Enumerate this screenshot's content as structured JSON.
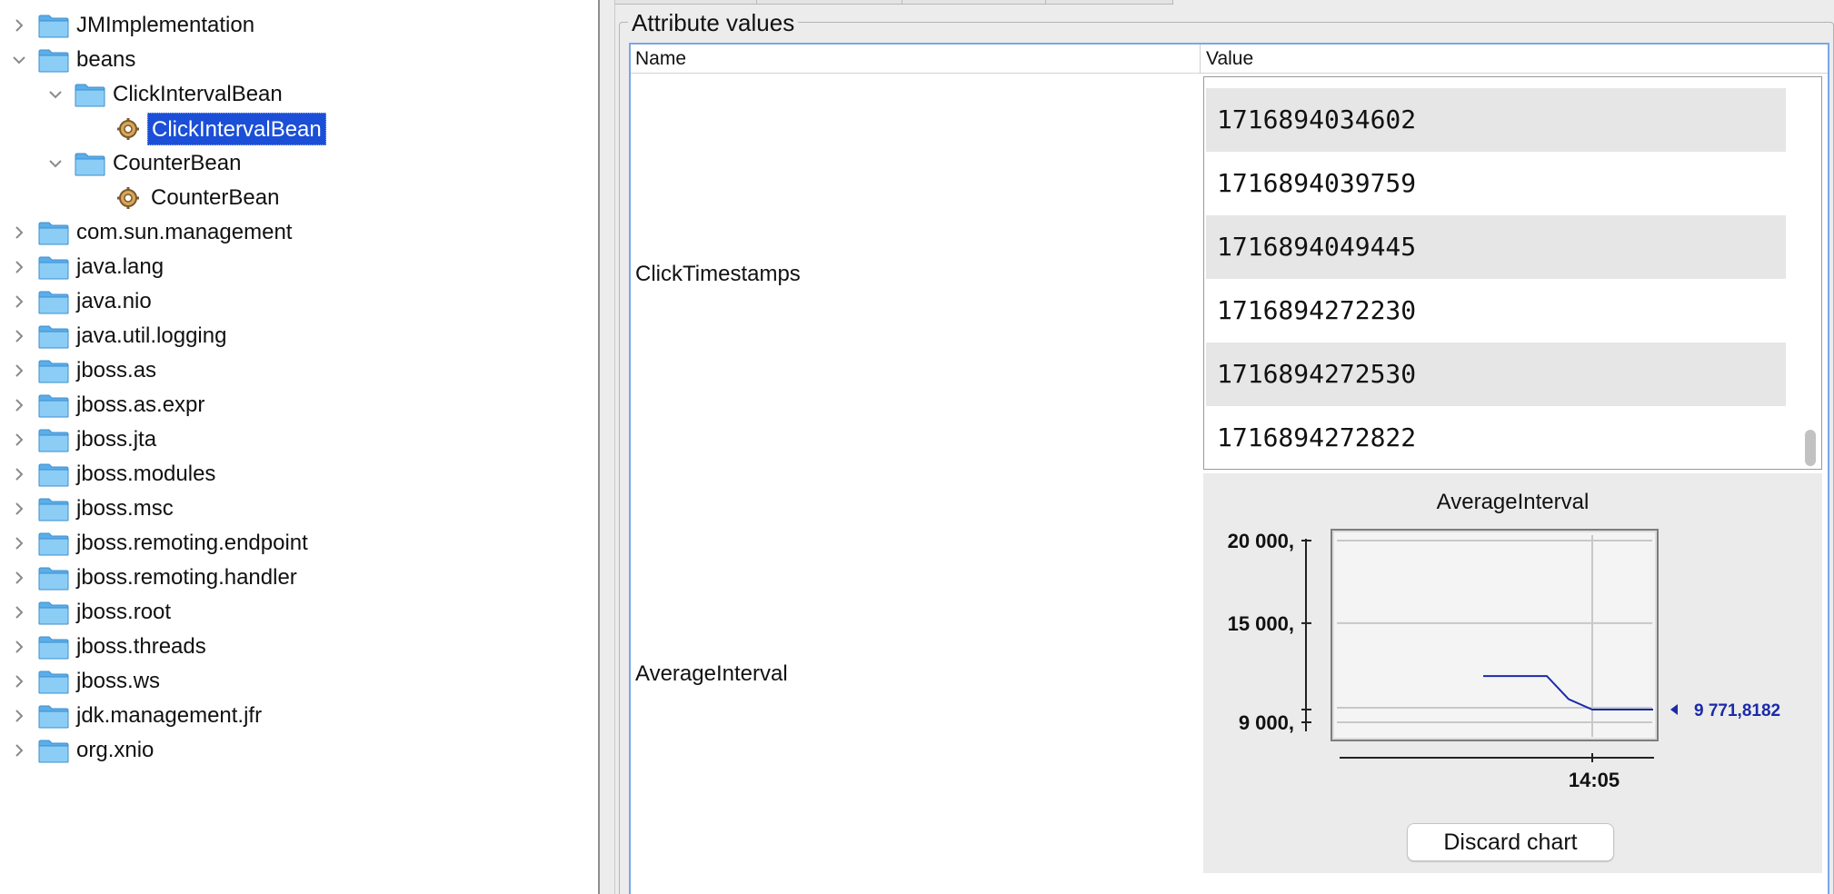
{
  "tree": {
    "items": [
      {
        "label": "JMImplementation",
        "level": 0,
        "type": "folder",
        "expanded": false
      },
      {
        "label": "beans",
        "level": 0,
        "type": "folder",
        "expanded": true
      },
      {
        "label": "ClickIntervalBean",
        "level": 1,
        "type": "folder",
        "expanded": true
      },
      {
        "label": "ClickIntervalBean",
        "level": 2,
        "type": "bean",
        "selected": true
      },
      {
        "label": "CounterBean",
        "level": 1,
        "type": "folder",
        "expanded": true
      },
      {
        "label": "CounterBean",
        "level": 2,
        "type": "bean"
      },
      {
        "label": "com.sun.management",
        "level": 0,
        "type": "folder",
        "expanded": false
      },
      {
        "label": "java.lang",
        "level": 0,
        "type": "folder",
        "expanded": false
      },
      {
        "label": "java.nio",
        "level": 0,
        "type": "folder",
        "expanded": false
      },
      {
        "label": "java.util.logging",
        "level": 0,
        "type": "folder",
        "expanded": false
      },
      {
        "label": "jboss.as",
        "level": 0,
        "type": "folder",
        "expanded": false
      },
      {
        "label": "jboss.as.expr",
        "level": 0,
        "type": "folder",
        "expanded": false
      },
      {
        "label": "jboss.jta",
        "level": 0,
        "type": "folder",
        "expanded": false
      },
      {
        "label": "jboss.modules",
        "level": 0,
        "type": "folder",
        "expanded": false
      },
      {
        "label": "jboss.msc",
        "level": 0,
        "type": "folder",
        "expanded": false
      },
      {
        "label": "jboss.remoting.endpoint",
        "level": 0,
        "type": "folder",
        "expanded": false
      },
      {
        "label": "jboss.remoting.handler",
        "level": 0,
        "type": "folder",
        "expanded": false
      },
      {
        "label": "jboss.root",
        "level": 0,
        "type": "folder",
        "expanded": false
      },
      {
        "label": "jboss.threads",
        "level": 0,
        "type": "folder",
        "expanded": false
      },
      {
        "label": "jboss.ws",
        "level": 0,
        "type": "folder",
        "expanded": false
      },
      {
        "label": "jdk.management.jfr",
        "level": 0,
        "type": "folder",
        "expanded": false
      },
      {
        "label": "org.xnio",
        "level": 0,
        "type": "folder",
        "expanded": false
      }
    ]
  },
  "panel": {
    "title": "Attribute values",
    "columns": {
      "name": "Name",
      "value": "Value"
    },
    "attributes": {
      "click_timestamps": {
        "name": "ClickTimestamps",
        "values": [
          "1716894034602",
          "1716894039759",
          "1716894049445",
          "1716894272230",
          "1716894272530",
          "1716894272822"
        ]
      },
      "average_interval": {
        "name": "AverageInterval"
      }
    },
    "discard_button": "Discard chart"
  },
  "chart_data": {
    "type": "line",
    "title": "AverageInterval",
    "y_ticks": [
      "20 000,",
      "15 000,",
      "9 000,"
    ],
    "y_tick_values": [
      20000,
      15000,
      9000
    ],
    "x_tick": "14:05",
    "ylim": [
      9000,
      20000
    ],
    "current_value_label": "9 771,8182",
    "series": [
      {
        "values": [
          11800,
          11800,
          11800,
          11800,
          11800,
          10400,
          9771.8182,
          9771.8182,
          9771.8182,
          9771.8182
        ]
      }
    ],
    "line_color": "#1a2aa8"
  }
}
